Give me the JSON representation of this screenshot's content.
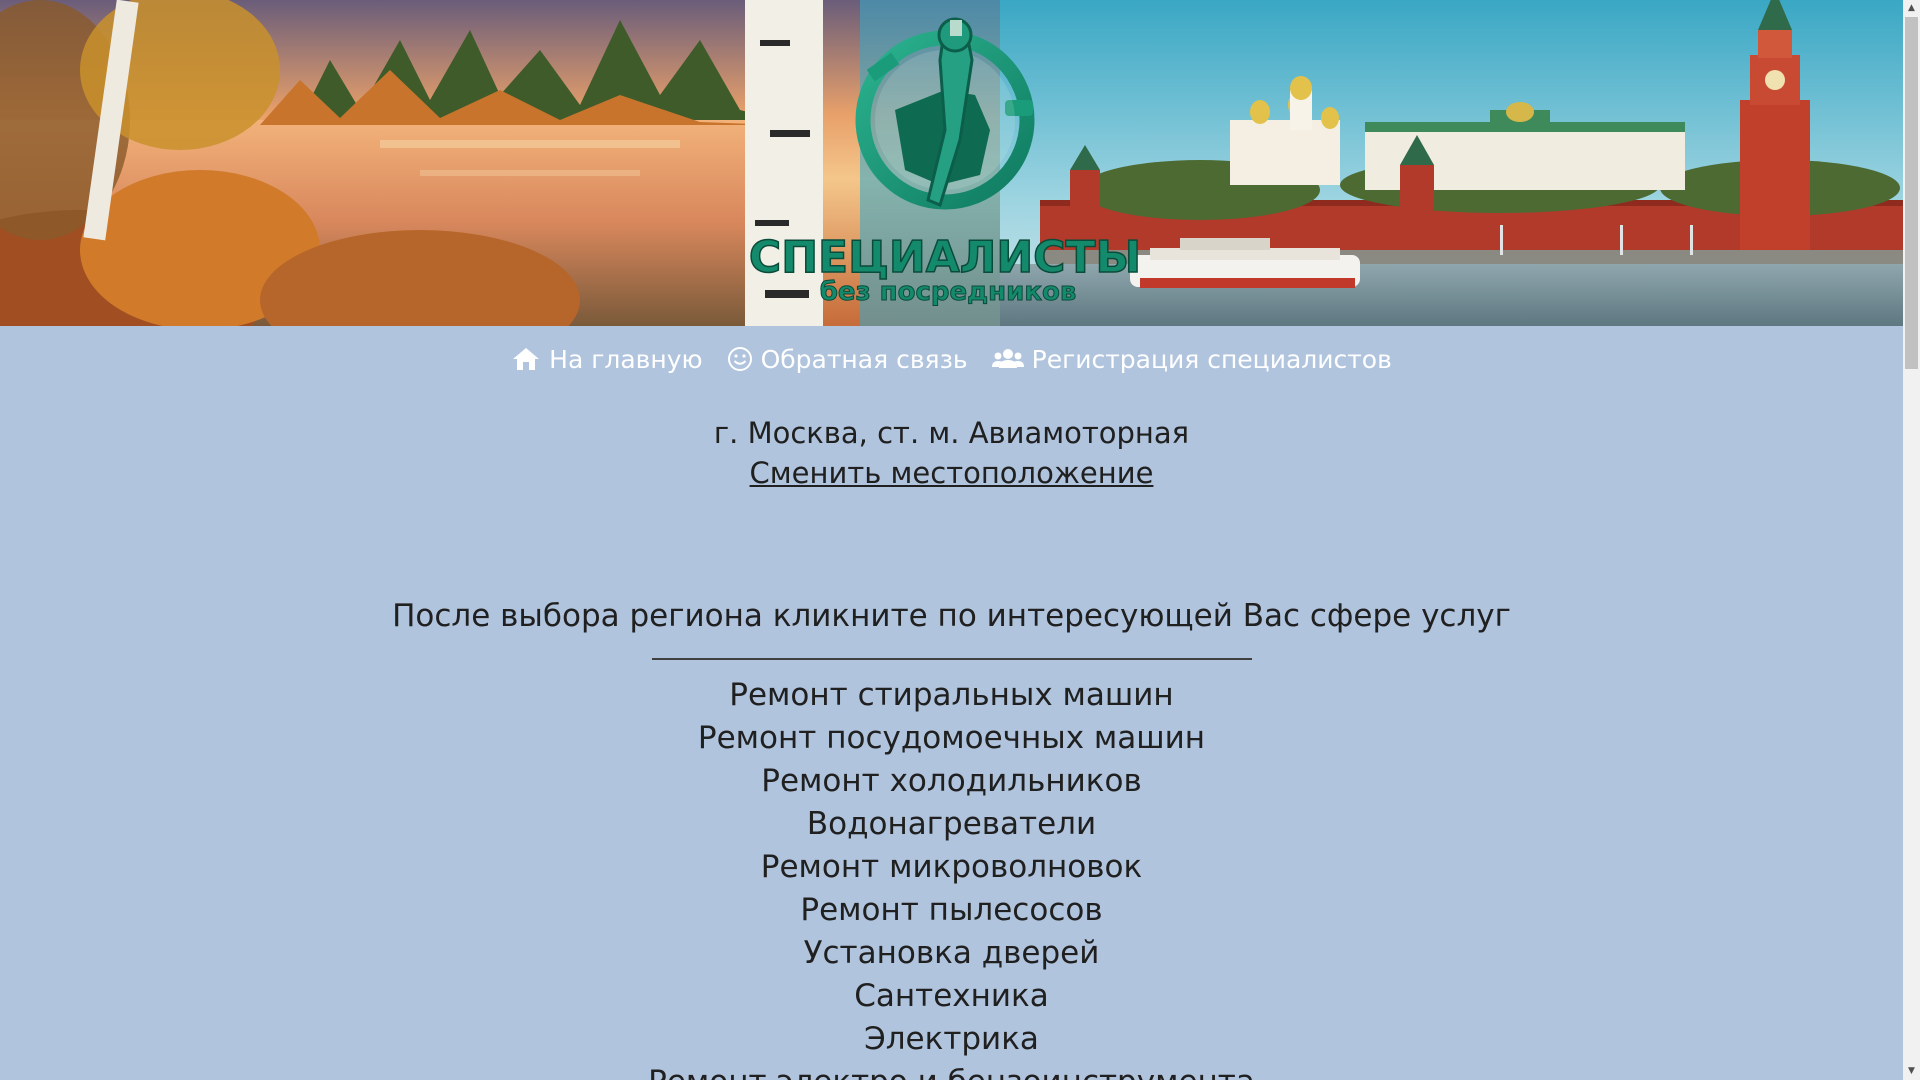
{
  "logo": {
    "title": "СПЕЦИАЛИСТЫ",
    "subtitle": "без посредников"
  },
  "nav": {
    "items": [
      {
        "label": "На главную",
        "icon": "home-icon"
      },
      {
        "label": "Обратная связь",
        "icon": "smile-icon"
      },
      {
        "label": "Регистрация специалистов",
        "icon": "users-icon"
      }
    ]
  },
  "location": {
    "city": "г. Москва, ст. м. Авиамоторная",
    "change_label": "Сменить местоположение"
  },
  "services": {
    "instruction": "После выбора региона кликните по интересующей Вас сфере услуг",
    "items": [
      "Ремонт стиральных машин",
      "Ремонт посудомоечных машин",
      "Ремонт холодильников",
      "Водонагреватели",
      "Ремонт микроволновок",
      "Ремонт пылесосов",
      "Установка дверей",
      "Сантехника",
      "Электрика",
      "Ремонт электро и бензоинструмента"
    ]
  },
  "colors": {
    "background": "#b0c4de",
    "logo_green": "#1a9c7a",
    "logo_dark": "#0b5e4a",
    "text": "#202020",
    "nav_text": "#ffffff"
  }
}
